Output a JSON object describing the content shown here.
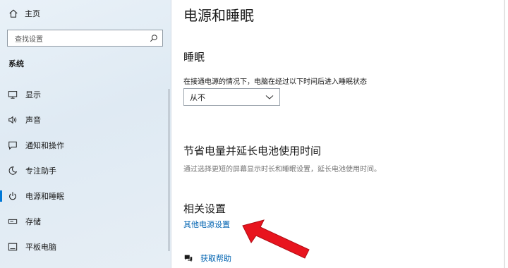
{
  "sidebar": {
    "home_label": "主页",
    "search_placeholder": "查找设置",
    "section_title": "系统",
    "items": [
      {
        "label": "显示",
        "icon": "monitor-icon"
      },
      {
        "label": "声音",
        "icon": "speaker-icon"
      },
      {
        "label": "通知和操作",
        "icon": "notification-icon"
      },
      {
        "label": "专注助手",
        "icon": "moon-icon"
      },
      {
        "label": "电源和睡眠",
        "icon": "power-icon",
        "active": true
      },
      {
        "label": "存储",
        "icon": "storage-icon"
      },
      {
        "label": "平板电脑",
        "icon": "tablet-icon"
      }
    ]
  },
  "main": {
    "title": "电源和睡眠",
    "sleep": {
      "heading": "睡眠",
      "description": "在接通电源的情况下，电脑在经过以下时间后进入睡眠状态",
      "dropdown_value": "从不"
    },
    "battery": {
      "heading": "节省电量并延长电池使用时间",
      "description": "通过选择更短的屏幕显示时长和睡眠设置，延长电池使用时间。"
    },
    "related": {
      "heading": "相关设置",
      "link": "其他电源设置"
    },
    "help_label": "获取帮助"
  },
  "colors": {
    "accent": "#0078d7",
    "link": "#0063b1",
    "annotation_arrow": "#e8141e"
  }
}
